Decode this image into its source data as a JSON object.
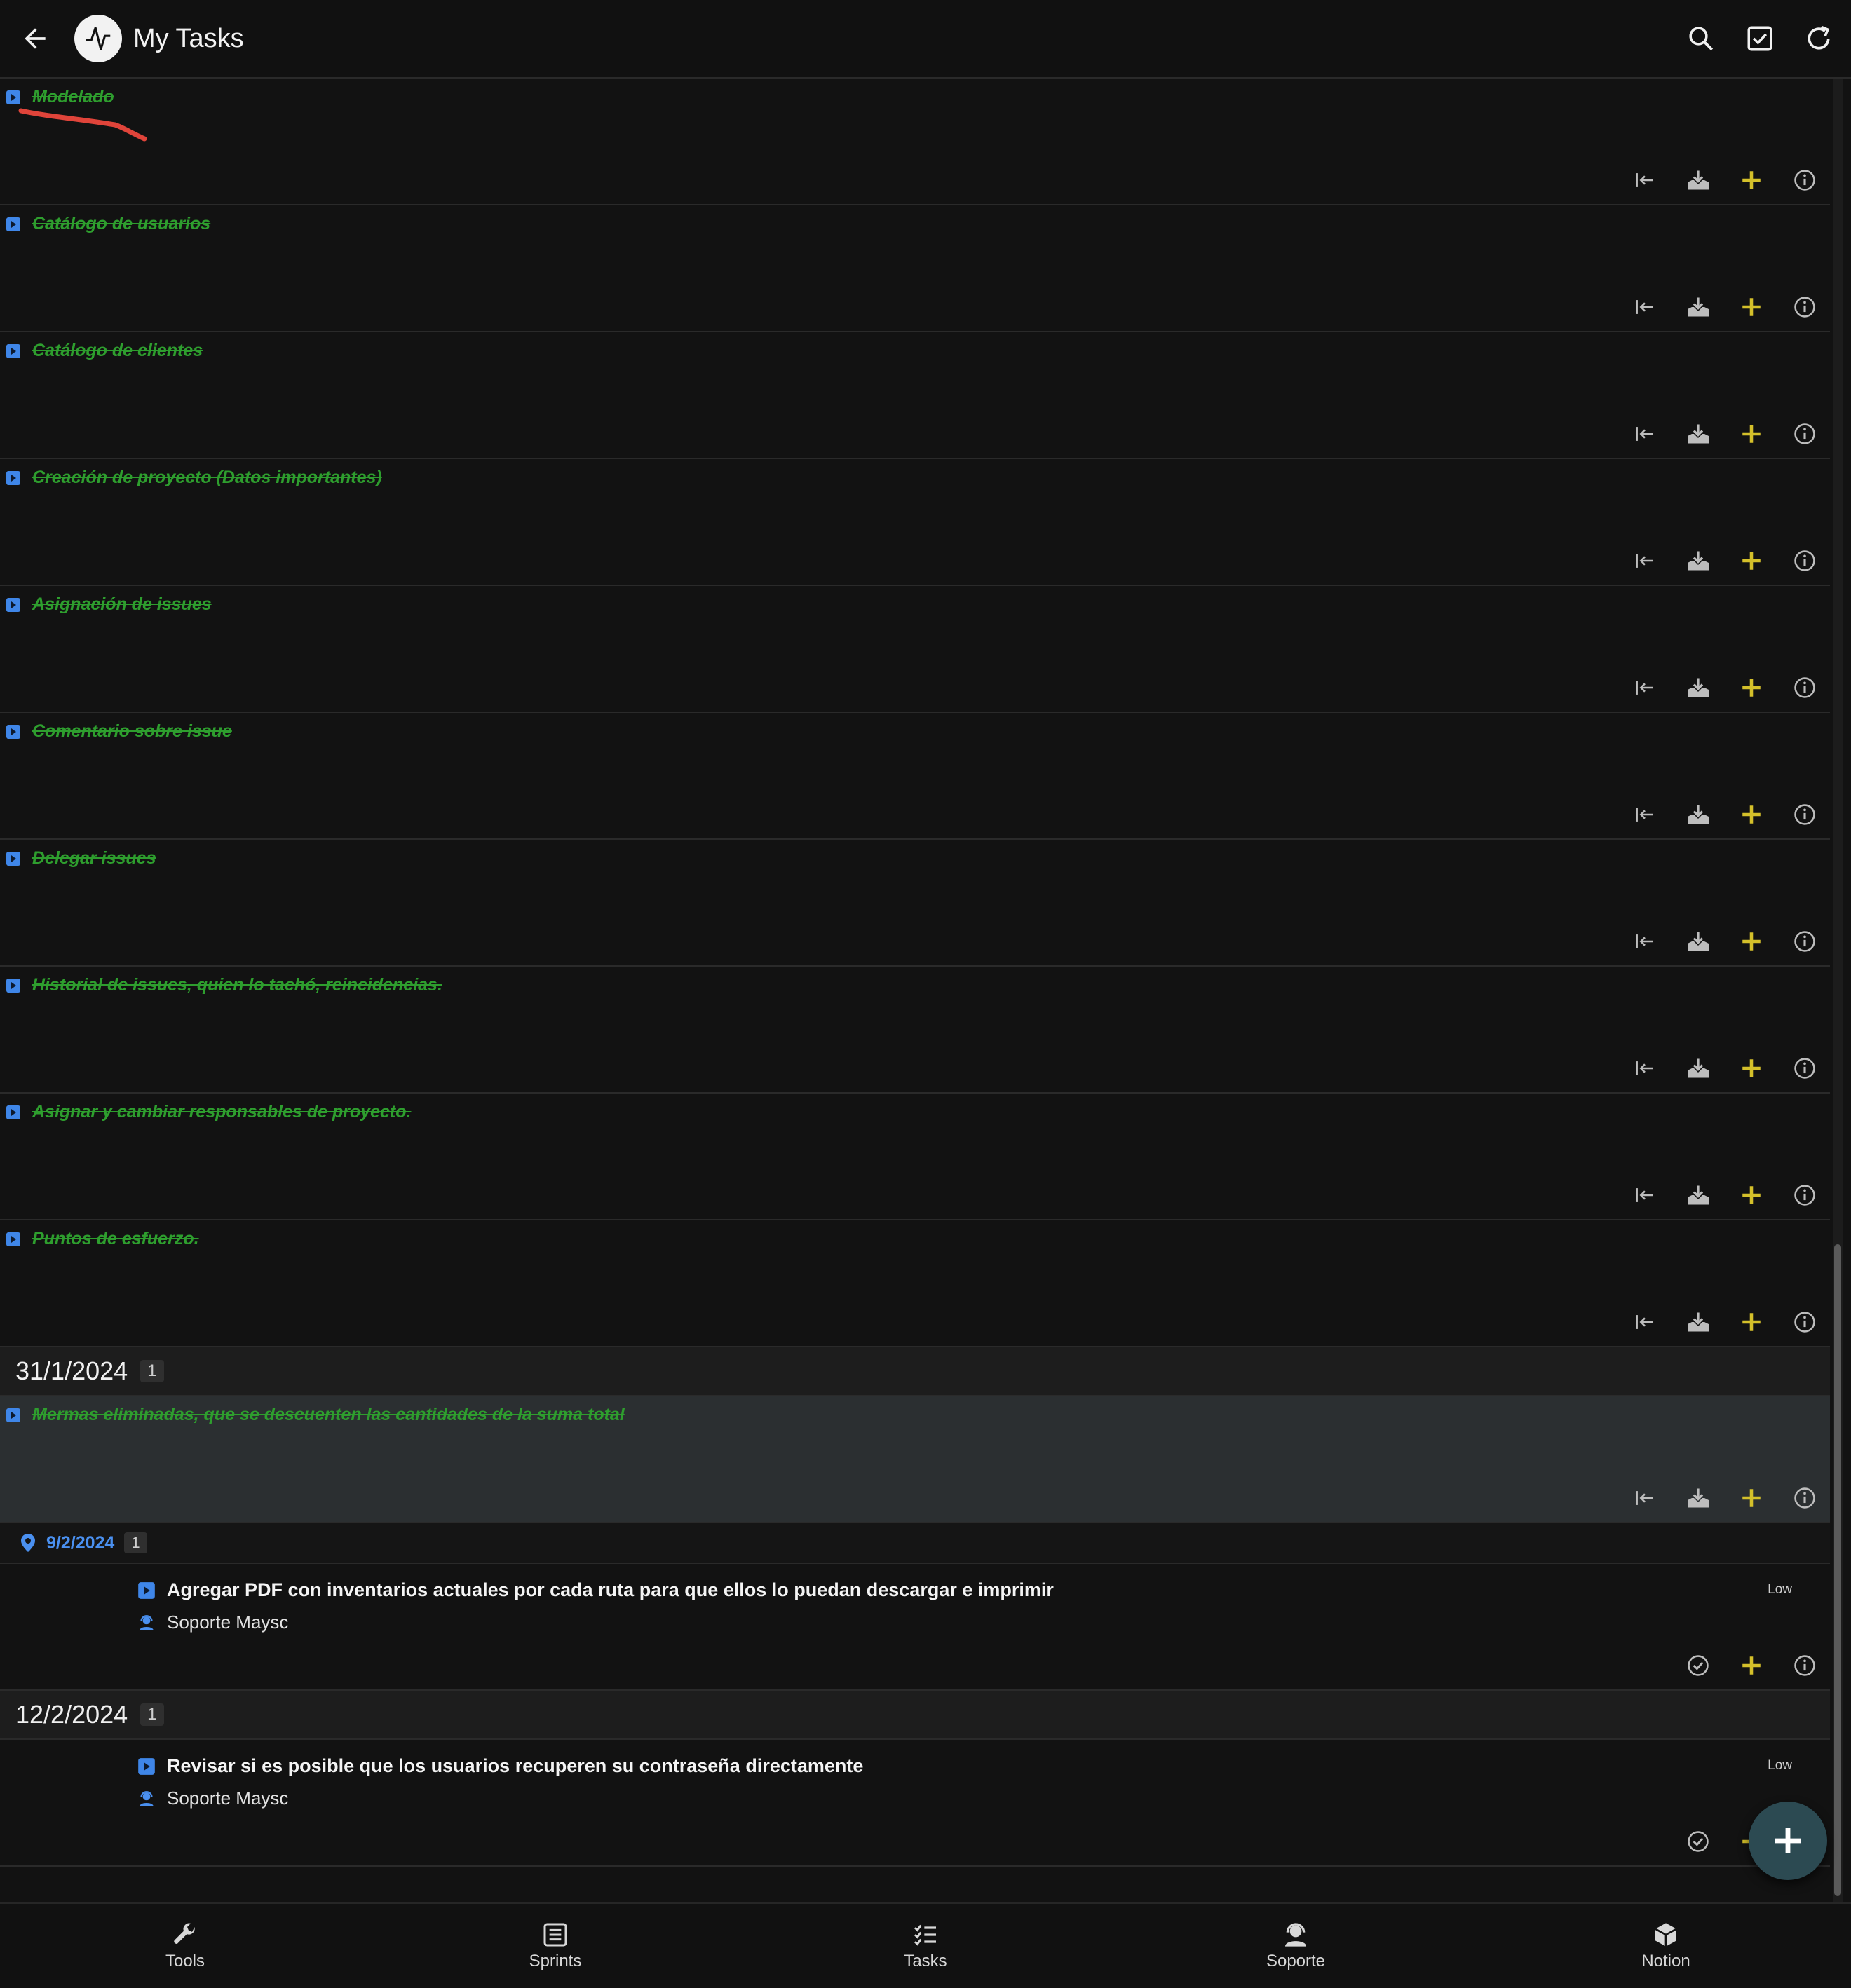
{
  "appbar": {
    "title": "My Tasks"
  },
  "done_tasks": [
    {
      "title": "Modelado"
    },
    {
      "title": "Catálogo de usuarios"
    },
    {
      "title": "Catálogo de clientes"
    },
    {
      "title": "Creación de proyecto (Datos importantes)"
    },
    {
      "title": "Asignación de issues"
    },
    {
      "title": "Comentario sobre issue"
    },
    {
      "title": "Delegar issues"
    },
    {
      "title": "Historial de issues, quien lo tachó, reincidencias."
    },
    {
      "title": "Asignar y cambiar responsables de proyecto."
    },
    {
      "title": "Puntos de esfuerzo."
    }
  ],
  "group1": {
    "date": "31/1/2024",
    "count": "1",
    "task": {
      "title": "Mermas eliminadas, que se descuenten las cantidades de la suma total"
    }
  },
  "group2": {
    "location_date": "9/2/2024",
    "count": "1",
    "issue": {
      "title": "Agregar PDF con inventarios actuales por cada ruta para que ellos lo puedan descargar e imprimir",
      "owner": "Soporte Maysc",
      "priority": "Low"
    }
  },
  "group3": {
    "date": "12/2/2024",
    "count": "1",
    "issue": {
      "title": "Revisar si es posible que los usuarios recuperen su contraseña directamente",
      "owner": "Soporte Maysc",
      "priority": "Low"
    }
  },
  "nav": {
    "tools": "Tools",
    "sprints": "Sprints",
    "tasks": "Tasks",
    "soporte": "Soporte",
    "notion": "Notion"
  },
  "colors": {
    "done_title": "#2e9e2e",
    "accent_plus": "#d4c02a",
    "blue": "#4a90f0",
    "annotation": "#e0443a"
  }
}
